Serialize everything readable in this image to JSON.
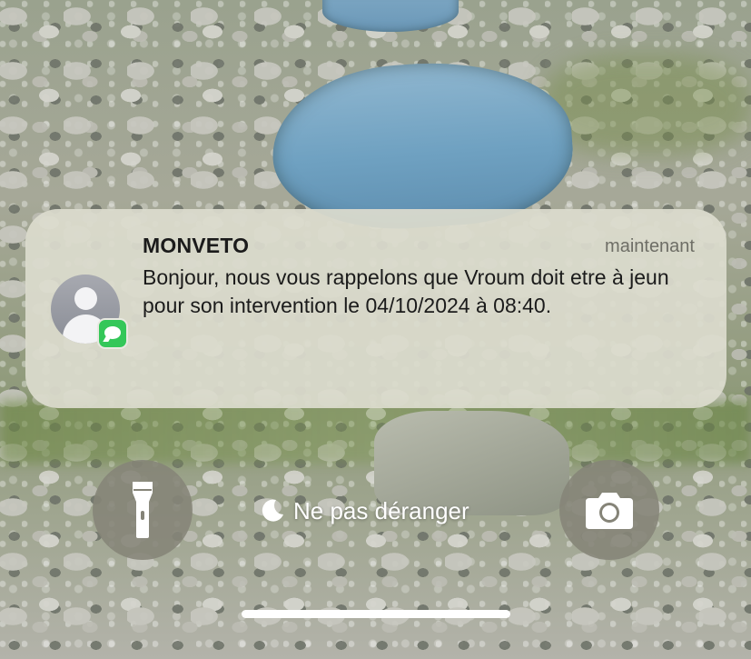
{
  "notification": {
    "sender": "MONVETO",
    "timestamp": "maintenant",
    "message": "Bonjour, nous vous rappelons que Vroum doit etre à jeun pour son intervention le 04/10/2024 à 08:40.",
    "app_icon": "messages-icon",
    "avatar_icon": "contact-avatar-icon"
  },
  "lockscreen": {
    "focus_label": "Ne pas déranger",
    "focus_icon": "moon-icon",
    "left_button_icon": "flashlight-icon",
    "right_button_icon": "camera-icon"
  },
  "colors": {
    "messages_green": "#34c759",
    "notification_bg": "#dcdbcd",
    "control_button_bg": "#858478"
  }
}
